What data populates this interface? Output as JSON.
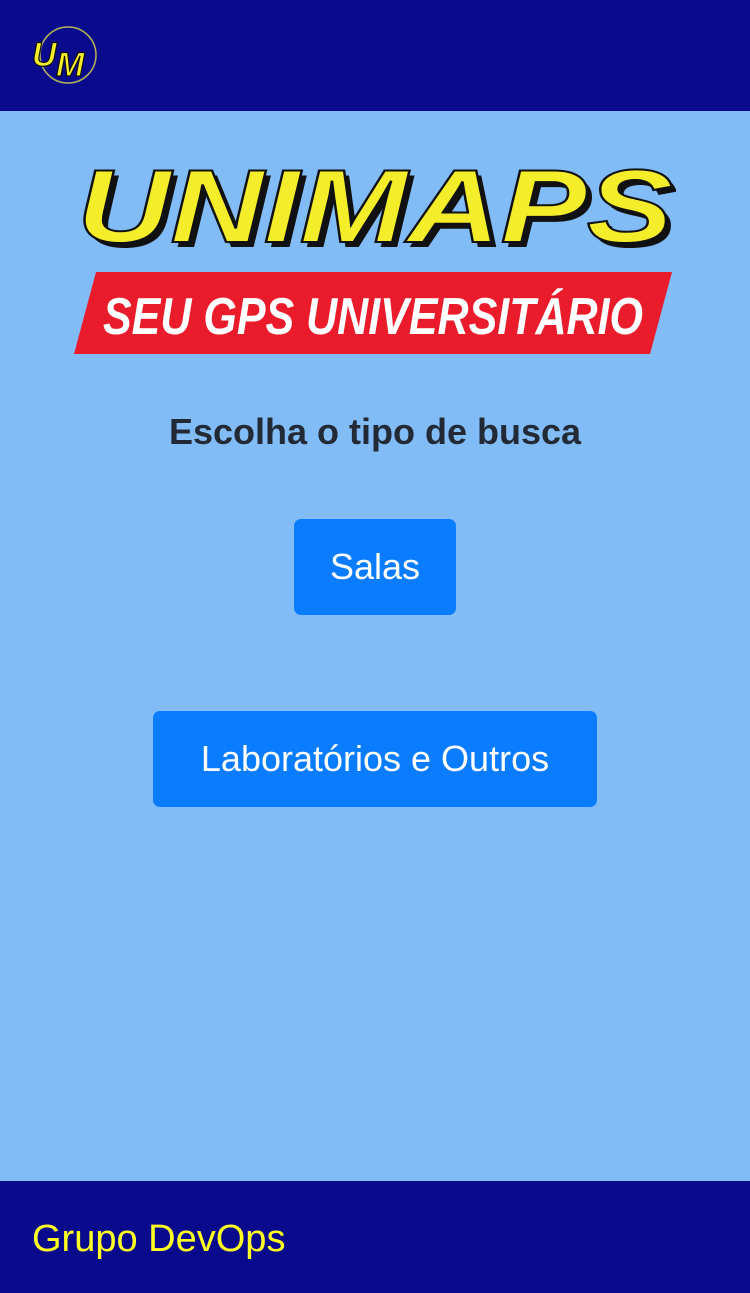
{
  "header": {
    "logo_icon": "um-logo-icon",
    "logo_text": "UM"
  },
  "hero": {
    "brand": "UNIMAPS",
    "tagline": "SEU GPS UNIVERSITÁRIO"
  },
  "main": {
    "heading": "Escolha o tipo de busca",
    "buttons": [
      {
        "label": "Salas"
      },
      {
        "label": "Laboratórios e Outros"
      }
    ]
  },
  "footer": {
    "text": "Grupo DevOps"
  },
  "colors": {
    "header_bg": "#0a0a8c",
    "page_bg": "#82bcf7",
    "button_bg": "#0a7cff",
    "brand_yellow": "#f4ee2a",
    "banner_red": "#ea1c2c",
    "footer_text": "#ffff22"
  }
}
